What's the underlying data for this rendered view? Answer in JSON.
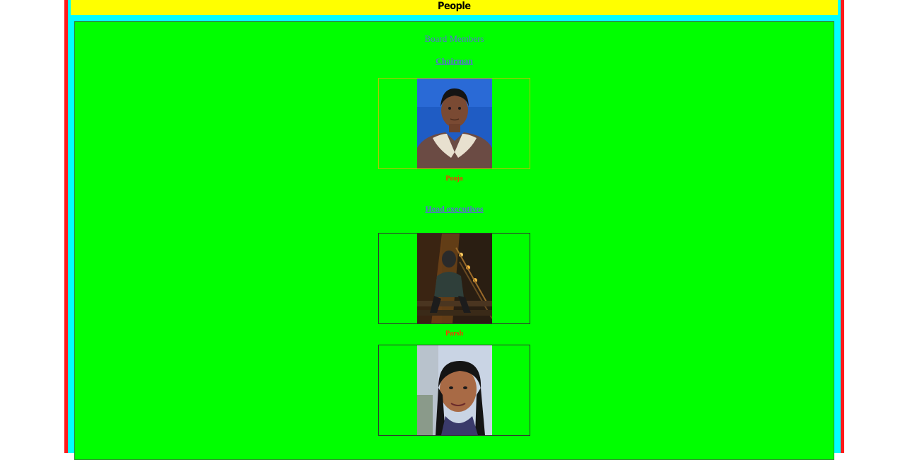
{
  "header": {
    "title": "People"
  },
  "board": {
    "caption": "Board Members",
    "chairman_heading": "Chairman",
    "chairman": {
      "name": "Pooja",
      "photo_icon": "portrait-photo"
    },
    "executives_heading": "Head executives",
    "executives": [
      {
        "name": "Parsh",
        "photo_icon": "portrait-photo"
      },
      {
        "name": "",
        "photo_icon": "portrait-photo"
      }
    ]
  },
  "colors": {
    "page_border": "#ff1a1a",
    "inner_border": "#00ffff",
    "header_bg": "#ffff00",
    "panel_bg": "#00ff00",
    "link": "#5b6bd6",
    "name": "#ff3300"
  }
}
